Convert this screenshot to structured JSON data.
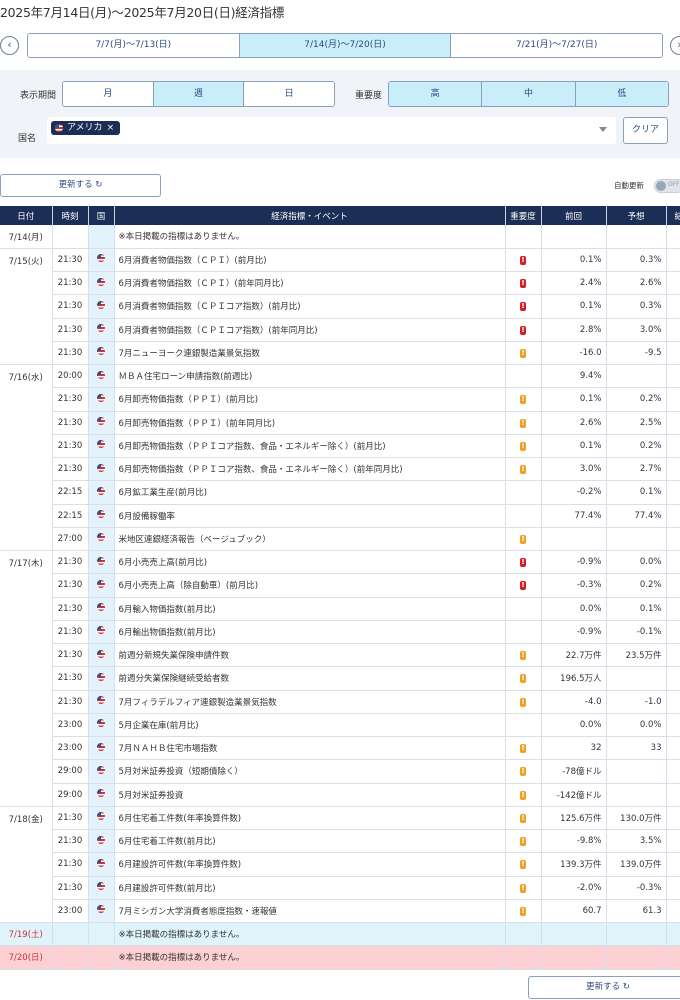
{
  "title": "2025年7月14日(月)～2025年7月20日(日)経済指標",
  "week_nav": {
    "prev_icon": "chevron-left-icon",
    "next_icon": "chevron-right-icon",
    "weeks": [
      "7/7(月)～7/13(日)",
      "7/14(月)～7/20(日)",
      "7/21(月)～7/27(日)"
    ],
    "active": 1
  },
  "filters": {
    "period_label": "表示期間",
    "period_options": [
      "月",
      "週",
      "日"
    ],
    "period_selected": "週",
    "importance_label": "重要度",
    "importance_options": [
      "高",
      "中",
      "低"
    ],
    "country_label": "国名",
    "country_chip": "アメリカ",
    "chip_remove": "×",
    "clear_label": "クリア"
  },
  "refresh_label": "更新する ↻",
  "auto_refresh_label": "自動更新",
  "auto_refresh_state": "OFF",
  "colors": {
    "header_bg": "#1b2e55",
    "high": "#d0202a",
    "medium": "#f0a020",
    "accent": "#c9eefa",
    "saturday": "#dff3fa",
    "sunday": "#fdd0d3"
  },
  "table": {
    "headers": [
      "日付",
      "時刻",
      "国",
      "経済指標・イベント",
      "重要度",
      "前回",
      "予想",
      "結果"
    ],
    "no_data": "※本日掲載の指標はありません。",
    "days": [
      {
        "date": "7/14(月)",
        "rows": []
      },
      {
        "date": "7/15(火)",
        "rows": [
          {
            "time": "21:30",
            "event": "6月消費者物価指数（ＣＰＩ）(前月比)",
            "importance": "high",
            "prev": "0.1%",
            "forecast": "0.3%"
          },
          {
            "time": "21:30",
            "event": "6月消費者物価指数（ＣＰＩ）(前年同月比)",
            "importance": "high",
            "prev": "2.4%",
            "forecast": "2.6%"
          },
          {
            "time": "21:30",
            "event": "6月消費者物価指数（ＣＰＩコア指数）(前月比)",
            "importance": "high",
            "prev": "0.1%",
            "forecast": "0.3%"
          },
          {
            "time": "21:30",
            "event": "6月消費者物価指数（ＣＰＩコア指数）(前年同月比)",
            "importance": "high",
            "prev": "2.8%",
            "forecast": "3.0%"
          },
          {
            "time": "21:30",
            "event": "7月ニューヨーク連銀製造業景気指数",
            "importance": "medium",
            "prev": "-16.0",
            "forecast": "-9.5"
          }
        ]
      },
      {
        "date": "7/16(水)",
        "rows": [
          {
            "time": "20:00",
            "event": "ＭＢＡ住宅ローン申請指数(前週比)",
            "importance": "",
            "prev": "9.4%",
            "forecast": ""
          },
          {
            "time": "21:30",
            "event": "6月卸売物価指数（ＰＰＩ）(前月比)",
            "importance": "medium",
            "prev": "0.1%",
            "forecast": "0.2%"
          },
          {
            "time": "21:30",
            "event": "6月卸売物価指数（ＰＰＩ）(前年同月比)",
            "importance": "medium",
            "prev": "2.6%",
            "forecast": "2.5%"
          },
          {
            "time": "21:30",
            "event": "6月卸売物価指数（ＰＰＩコア指数、食品・エネルギー除く）(前月比)",
            "importance": "medium",
            "prev": "0.1%",
            "forecast": "0.2%"
          },
          {
            "time": "21:30",
            "event": "6月卸売物価指数（ＰＰＩコア指数、食品・エネルギー除く）(前年同月比)",
            "importance": "medium",
            "prev": "3.0%",
            "forecast": "2.7%"
          },
          {
            "time": "22:15",
            "event": "6月鉱工業生産(前月比)",
            "importance": "",
            "prev": "-0.2%",
            "forecast": "0.1%"
          },
          {
            "time": "22:15",
            "event": "6月設備稼働率",
            "importance": "",
            "prev": "77.4%",
            "forecast": "77.4%"
          },
          {
            "time": "27:00",
            "event": "米地区連銀経済報告（ベージュブック）",
            "importance": "medium",
            "prev": "",
            "forecast": ""
          }
        ]
      },
      {
        "date": "7/17(木)",
        "rows": [
          {
            "time": "21:30",
            "event": "6月小売売上高(前月比)",
            "importance": "high",
            "prev": "-0.9%",
            "forecast": "0.0%"
          },
          {
            "time": "21:30",
            "event": "6月小売売上高（除自動車）(前月比)",
            "importance": "high",
            "prev": "-0.3%",
            "forecast": "0.2%"
          },
          {
            "time": "21:30",
            "event": "6月輸入物価指数(前月比)",
            "importance": "",
            "prev": "0.0%",
            "forecast": "0.1%"
          },
          {
            "time": "21:30",
            "event": "6月輸出物価指数(前月比)",
            "importance": "",
            "prev": "-0.9%",
            "forecast": "-0.1%"
          },
          {
            "time": "21:30",
            "event": "前週分新規失業保険申請件数",
            "importance": "medium",
            "prev": "22.7万件",
            "forecast": "23.5万件"
          },
          {
            "time": "21:30",
            "event": "前週分失業保険継続受給者数",
            "importance": "medium",
            "prev": "196.5万人",
            "forecast": ""
          },
          {
            "time": "21:30",
            "event": "7月フィラデルフィア連銀製造業景気指数",
            "importance": "medium",
            "prev": "-4.0",
            "forecast": "-1.0"
          },
          {
            "time": "23:00",
            "event": "5月企業在庫(前月比)",
            "importance": "",
            "prev": "0.0%",
            "forecast": "0.0%"
          },
          {
            "time": "23:00",
            "event": "7月ＮＡＨＢ住宅市場指数",
            "importance": "medium",
            "prev": "32",
            "forecast": "33"
          },
          {
            "time": "29:00",
            "event": "5月対米証券投資（短期債除く）",
            "importance": "medium",
            "prev": "-78億ドル",
            "forecast": ""
          },
          {
            "time": "29:00",
            "event": "5月対米証券投資",
            "importance": "medium",
            "prev": "-142億ドル",
            "forecast": ""
          }
        ]
      },
      {
        "date": "7/18(金)",
        "rows": [
          {
            "time": "21:30",
            "event": "6月住宅着工件数(年率換算件数)",
            "importance": "medium",
            "prev": "125.6万件",
            "forecast": "130.0万件"
          },
          {
            "time": "21:30",
            "event": "6月住宅着工件数(前月比)",
            "importance": "medium",
            "prev": "-9.8%",
            "forecast": "3.5%"
          },
          {
            "time": "21:30",
            "event": "6月建設許可件数(年率換算件数)",
            "importance": "medium",
            "prev": "139.3万件",
            "forecast": "139.0万件"
          },
          {
            "time": "21:30",
            "event": "6月建設許可件数(前月比)",
            "importance": "medium",
            "prev": "-2.0%",
            "forecast": "-0.3%"
          },
          {
            "time": "23:00",
            "event": "7月ミシガン大学消費者態度指数・速報値",
            "importance": "medium",
            "prev": "60.7",
            "forecast": "61.3"
          }
        ]
      },
      {
        "date": "7/19(土)",
        "rows": [],
        "kind": "sat"
      },
      {
        "date": "7/20(日)",
        "rows": [],
        "kind": "sun"
      }
    ]
  }
}
